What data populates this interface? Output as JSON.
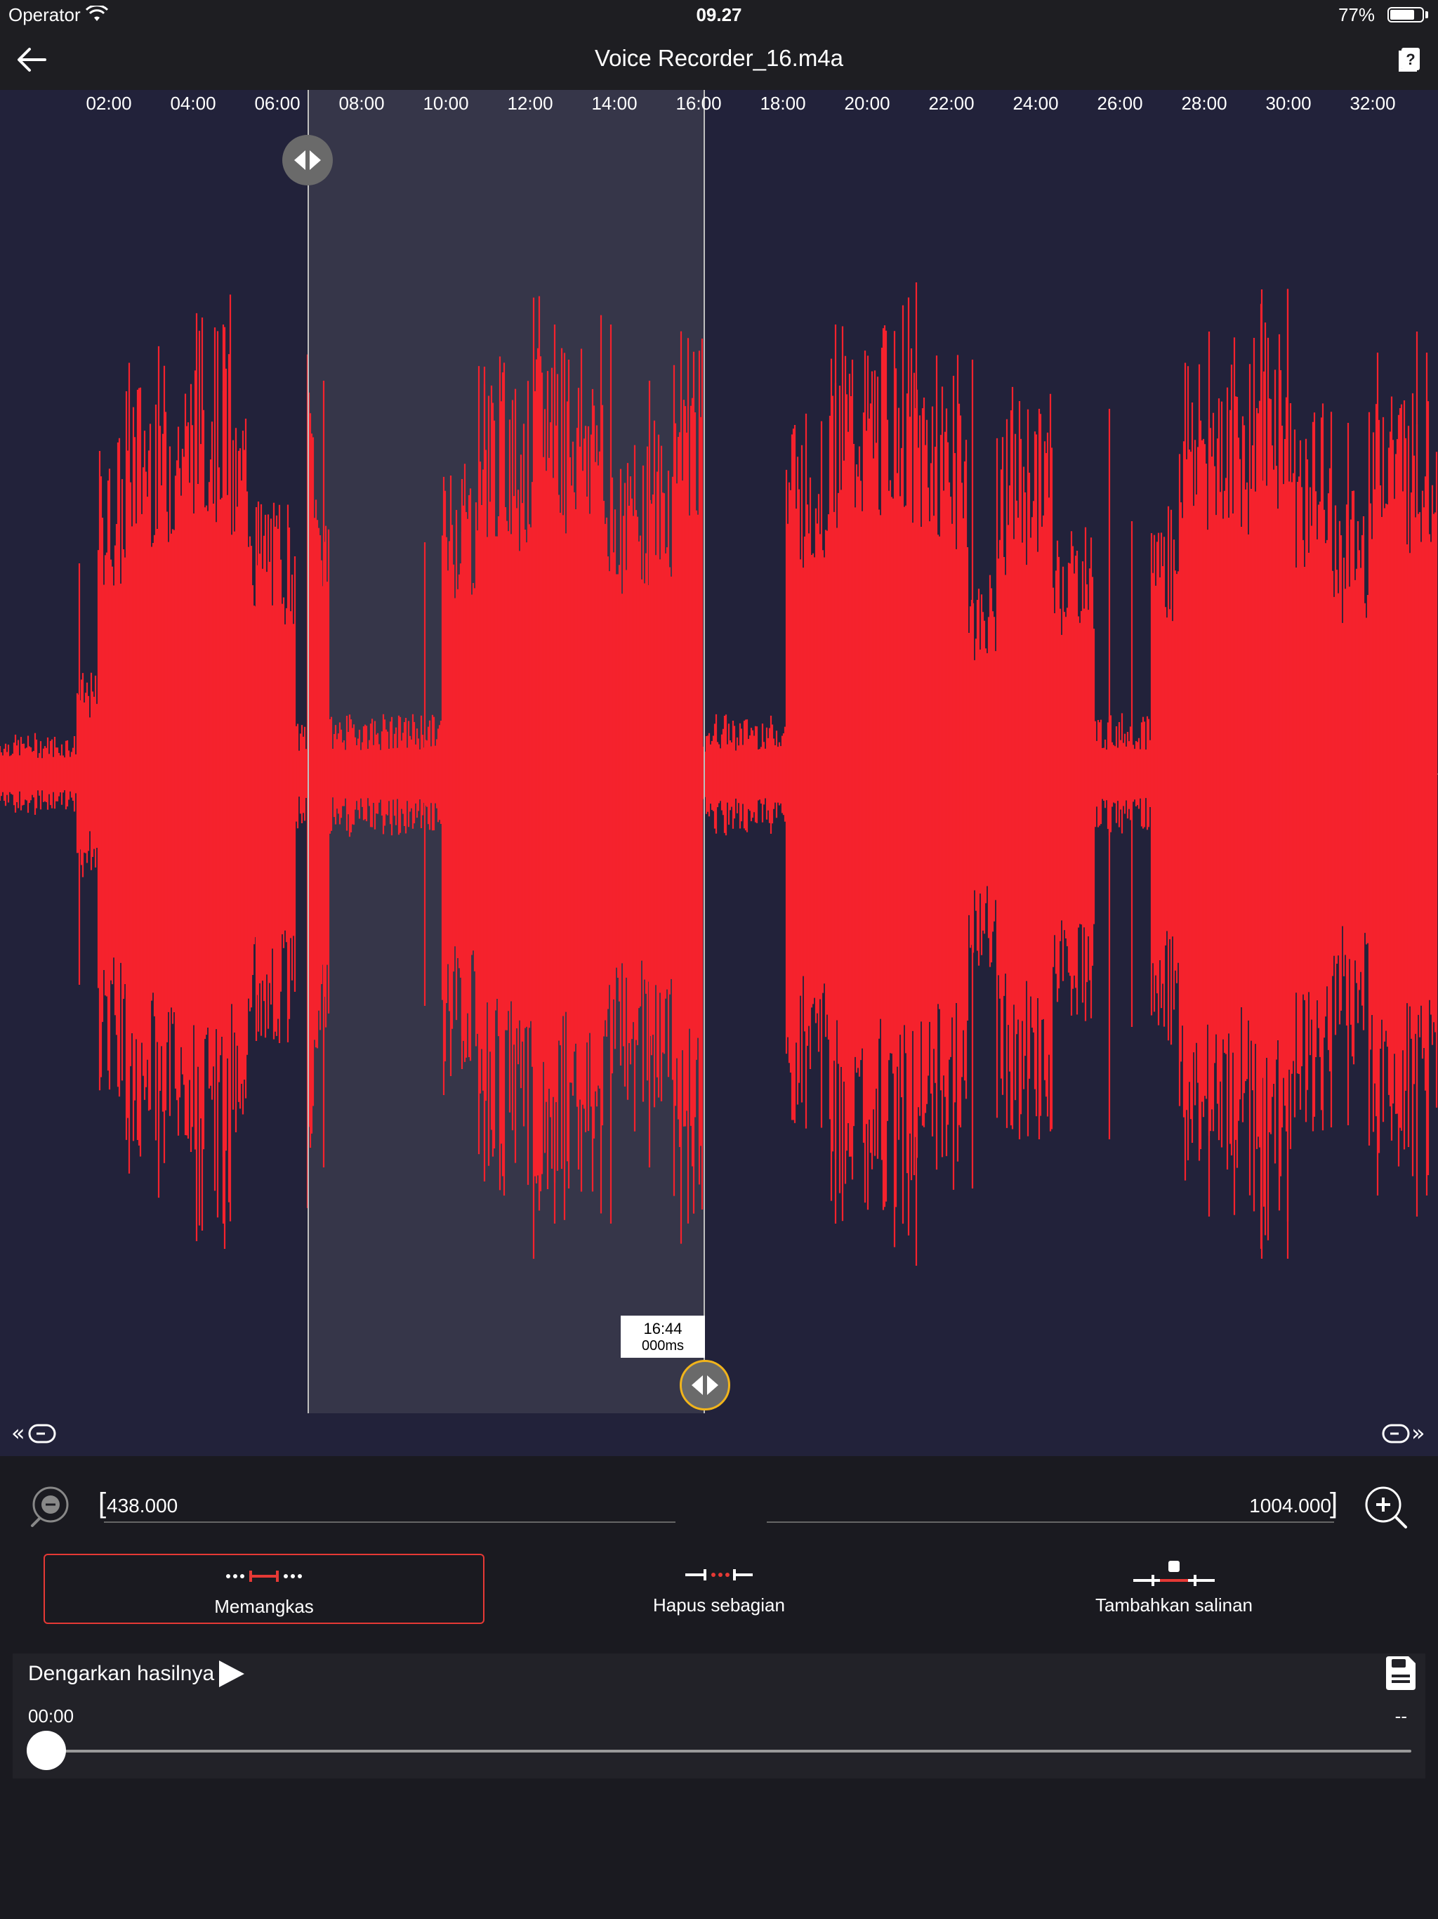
{
  "status_bar": {
    "carrier": "Operator",
    "time": "09.27",
    "battery_percent": "77%",
    "battery_level": 0.77
  },
  "nav": {
    "title": "Voice Recorder_16.m4a",
    "back_icon": "arrow-left-icon",
    "right_icon": "document-help-icon"
  },
  "timeline": {
    "ticks": [
      "02:00",
      "04:00",
      "06:00",
      "08:00",
      "10:00",
      "12:00",
      "14:00",
      "16:00",
      "18:00",
      "20:00",
      "22:00",
      "24:00",
      "26:00",
      "28:00",
      "30:00",
      "32:00"
    ]
  },
  "selection": {
    "marker_time": "16:44",
    "marker_ms": "000ms"
  },
  "range": {
    "start": "438.000",
    "end": "1004.000"
  },
  "modes": {
    "trim": "Memangkas",
    "delete": "Hapus sebagian",
    "copy": "Tambahkan salinan",
    "active": "trim"
  },
  "playback": {
    "label": "Dengarkan hasilnya",
    "current": "00:00",
    "duration": "--",
    "progress": 0
  },
  "colors": {
    "waveform": "#f5222d",
    "background": "#22223a",
    "selection": "#3a3a4c",
    "active_border": "#e53935",
    "end_handle_ring": "#f1b41b"
  }
}
